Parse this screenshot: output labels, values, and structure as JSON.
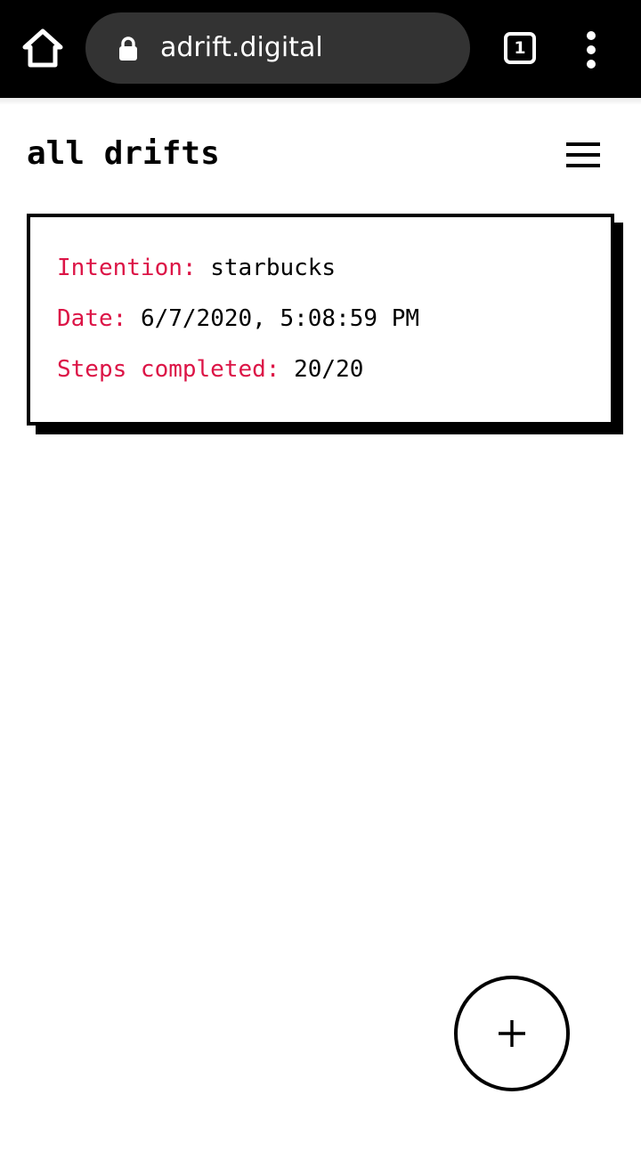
{
  "browser": {
    "url": "adrift.digital",
    "tab_count": "1"
  },
  "page": {
    "title": "all drifts"
  },
  "drifts": [
    {
      "intention_label": "Intention:",
      "intention": "starbucks",
      "date_label": "Date:",
      "date": "6/7/2020, 5:08:59 PM",
      "steps_label": "Steps completed:",
      "steps": "20/20"
    }
  ],
  "colors": {
    "label_accent": "#dc1446",
    "browser_bar": "#000000",
    "url_pill": "#333333"
  },
  "icons": {
    "home": "home-icon",
    "lock": "lock-icon",
    "overflow": "more-vert-icon",
    "menu": "hamburger-menu-icon",
    "add": "plus-icon"
  }
}
